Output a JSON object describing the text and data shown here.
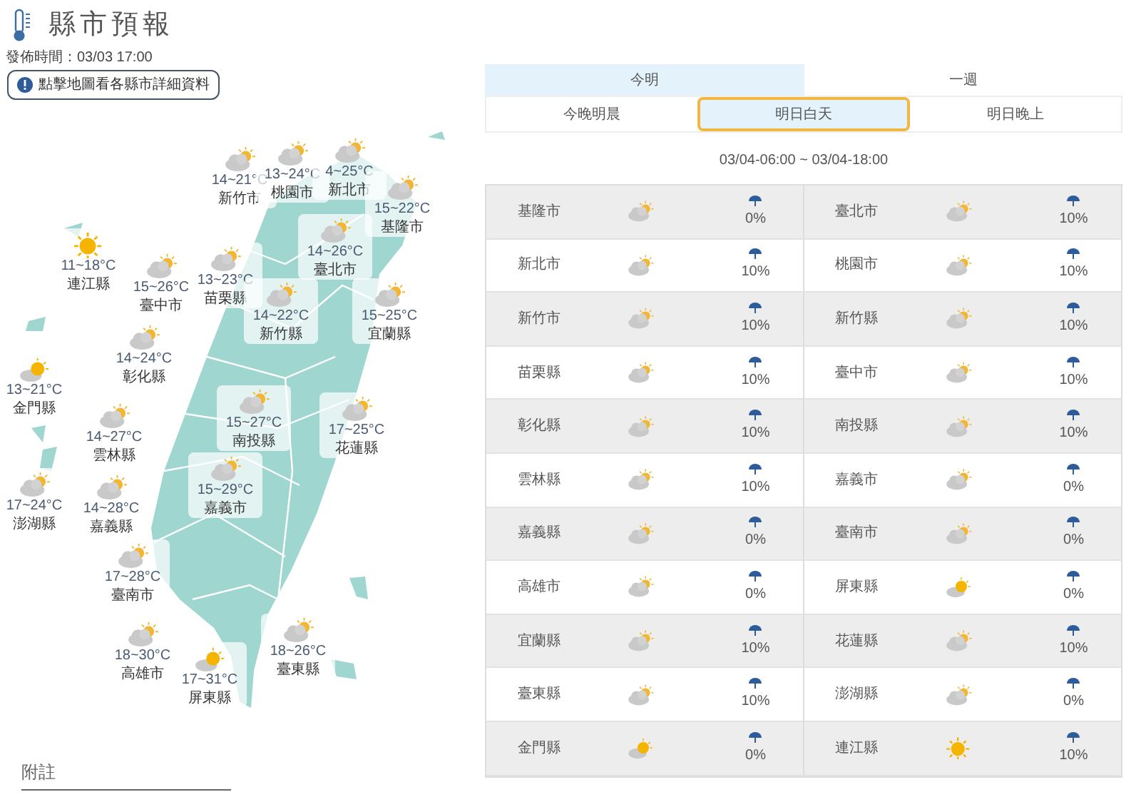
{
  "header": {
    "title": "縣市預報",
    "issued": "發佈時間：03/03 17:00",
    "map_hint_button": "點擊地圖看各縣市詳細資料"
  },
  "map_labels": [
    {
      "name": "新竹市",
      "temp": "14~21°C",
      "kind": "partly_cloudy"
    },
    {
      "name": "桃園市",
      "temp": "13~24°C",
      "kind": "partly_cloudy"
    },
    {
      "name": "新北市",
      "temp": "4~25°C",
      "kind": "partly_cloudy"
    },
    {
      "name": "基隆市",
      "temp": "15~22°C",
      "kind": "partly_cloudy"
    },
    {
      "name": "臺北市",
      "temp": "14~26°C",
      "kind": "partly_cloudy"
    },
    {
      "name": "連江縣",
      "temp": "11~18°C",
      "kind": "sunny"
    },
    {
      "name": "臺中市",
      "temp": "15~26°C",
      "kind": "partly_cloudy"
    },
    {
      "name": "苗栗縣",
      "temp": "13~23°C",
      "kind": "partly_cloudy"
    },
    {
      "name": "新竹縣",
      "temp": "14~22°C",
      "kind": "partly_cloudy"
    },
    {
      "name": "宜蘭縣",
      "temp": "15~25°C",
      "kind": "partly_cloudy"
    },
    {
      "name": "彰化縣",
      "temp": "14~24°C",
      "kind": "partly_cloudy"
    },
    {
      "name": "金門縣",
      "temp": "13~21°C",
      "kind": "sun_cloud"
    },
    {
      "name": "南投縣",
      "temp": "15~27°C",
      "kind": "partly_cloudy"
    },
    {
      "name": "花蓮縣",
      "temp": "17~25°C",
      "kind": "partly_cloudy"
    },
    {
      "name": "雲林縣",
      "temp": "14~27°C",
      "kind": "partly_cloudy"
    },
    {
      "name": "嘉義市",
      "temp": "15~29°C",
      "kind": "partly_cloudy"
    },
    {
      "name": "澎湖縣",
      "temp": "17~24°C",
      "kind": "partly_cloudy"
    },
    {
      "name": "嘉義縣",
      "temp": "14~28°C",
      "kind": "partly_cloudy"
    },
    {
      "name": "臺南市",
      "temp": "17~28°C",
      "kind": "partly_cloudy"
    },
    {
      "name": "高雄市",
      "temp": "18~30°C",
      "kind": "partly_cloudy"
    },
    {
      "name": "屏東縣",
      "temp": "17~31°C",
      "kind": "sun_cloud"
    },
    {
      "name": "臺東縣",
      "temp": "18~26°C",
      "kind": "partly_cloudy"
    }
  ],
  "notes_heading": "附註",
  "tabs": [
    {
      "label": "今明",
      "selected": true
    },
    {
      "label": "一週",
      "selected": false
    }
  ],
  "sub_tabs": [
    {
      "label": "今晚明晨",
      "selected": false
    },
    {
      "label": "明日白天",
      "selected": true
    },
    {
      "label": "明日晚上",
      "selected": false
    }
  ],
  "period": "03/04-06:00 ~ 03/04-18:00",
  "forecast_cells": [
    {
      "name": "基隆市",
      "kind": "partly_cloudy",
      "rain": "0%"
    },
    {
      "name": "臺北市",
      "kind": "partly_cloudy",
      "rain": "10%"
    },
    {
      "name": "新北市",
      "kind": "partly_cloudy",
      "rain": "10%"
    },
    {
      "name": "桃園市",
      "kind": "partly_cloudy",
      "rain": "10%"
    },
    {
      "name": "新竹市",
      "kind": "partly_cloudy",
      "rain": "10%"
    },
    {
      "name": "新竹縣",
      "kind": "partly_cloudy",
      "rain": "10%"
    },
    {
      "name": "苗栗縣",
      "kind": "partly_cloudy",
      "rain": "10%"
    },
    {
      "name": "臺中市",
      "kind": "partly_cloudy",
      "rain": "10%"
    },
    {
      "name": "彰化縣",
      "kind": "partly_cloudy",
      "rain": "10%"
    },
    {
      "name": "南投縣",
      "kind": "partly_cloudy",
      "rain": "10%"
    },
    {
      "name": "雲林縣",
      "kind": "partly_cloudy",
      "rain": "10%"
    },
    {
      "name": "嘉義市",
      "kind": "partly_cloudy",
      "rain": "0%"
    },
    {
      "name": "嘉義縣",
      "kind": "partly_cloudy",
      "rain": "0%"
    },
    {
      "name": "臺南市",
      "kind": "partly_cloudy",
      "rain": "0%"
    },
    {
      "name": "高雄市",
      "kind": "partly_cloudy",
      "rain": "0%"
    },
    {
      "name": "屏東縣",
      "kind": "sun_cloud",
      "rain": "0%"
    },
    {
      "name": "宜蘭縣",
      "kind": "partly_cloudy",
      "rain": "10%"
    },
    {
      "name": "花蓮縣",
      "kind": "partly_cloudy",
      "rain": "10%"
    },
    {
      "name": "臺東縣",
      "kind": "partly_cloudy",
      "rain": "10%"
    },
    {
      "name": "澎湖縣",
      "kind": "partly_cloudy",
      "rain": "0%"
    },
    {
      "name": "金門縣",
      "kind": "sun_cloud",
      "rain": "0%"
    },
    {
      "name": "連江縣",
      "kind": "sunny",
      "rain": "10%"
    }
  ]
}
